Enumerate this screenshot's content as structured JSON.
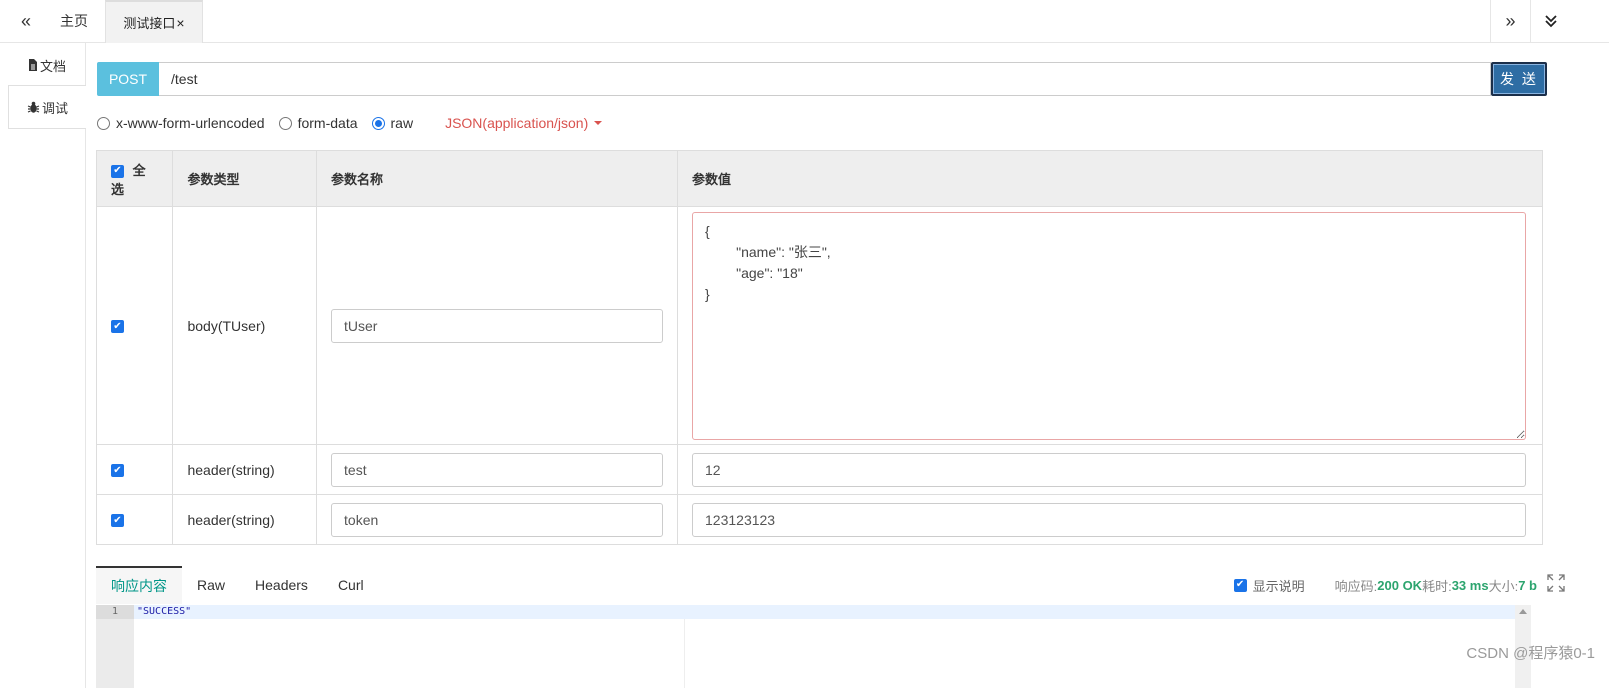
{
  "topbar": {
    "home_tab": "主页",
    "active_tab": "测试接口",
    "close_glyph": "×",
    "collapse_left_glyph": "«",
    "expand_right_glyph": "»",
    "menu_down_glyph": "⌄"
  },
  "sidenav": {
    "items": [
      {
        "label": "文档",
        "icon": "file-icon"
      },
      {
        "label": "调试",
        "icon": "bug-icon"
      }
    ]
  },
  "request": {
    "method": "POST",
    "url": "/test",
    "send_label": "发 送"
  },
  "body_types": {
    "options": [
      "x-www-form-urlencoded",
      "form-data",
      "raw"
    ],
    "selected": "raw",
    "content_type": "JSON(application/json)"
  },
  "params": {
    "headers": [
      "全选",
      "参数类型",
      "参数名称",
      "参数值"
    ],
    "select_all_checked": true,
    "rows": [
      {
        "checked": true,
        "type": "body(TUser)",
        "name": "tUser",
        "value": "{\n        \"name\": \"张三\",\n        \"age\": \"18\"\n}"
      },
      {
        "checked": true,
        "type": "header(string)",
        "name": "test",
        "value": "12"
      },
      {
        "checked": true,
        "type": "header(string)",
        "name": "token",
        "value": "123123123"
      }
    ]
  },
  "response": {
    "tabs": [
      "响应内容",
      "Raw",
      "Headers",
      "Curl"
    ],
    "active_tab": "响应内容",
    "show_desc_label": "显示说明",
    "show_desc_checked": true,
    "code_label": "响应码:",
    "code_value": "200 OK",
    "time_label": "耗时:",
    "time_value": "33 ms",
    "size_label": "大小:",
    "size_value": "7 b",
    "editor": {
      "line_number": "1",
      "line_text": "\"SUCCESS\""
    }
  },
  "watermark": "CSDN @程序猿0-1",
  "colors": {
    "method_bg": "#5bc0de",
    "send_bg": "#2e6da4",
    "content_type": "#d9534f",
    "active_tab": "#009688",
    "status_green": "#2ca46e",
    "checkbox": "#1a73e8"
  }
}
